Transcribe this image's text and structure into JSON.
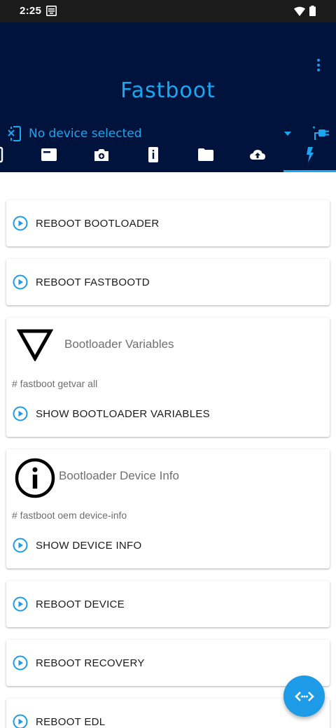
{
  "status_bar": {
    "time": "2:25"
  },
  "header": {
    "title": "Fastboot",
    "device_label": "No device selected"
  },
  "tabs": [
    {
      "icon": "phone-icon"
    },
    {
      "icon": "card-icon"
    },
    {
      "icon": "camera-icon"
    },
    {
      "icon": "info-icon"
    },
    {
      "icon": "folder-icon"
    },
    {
      "icon": "cloud-upload-icon"
    },
    {
      "icon": "flash-icon",
      "selected": true
    }
  ],
  "cards": {
    "reboot_bootloader": "REBOOT BOOTLOADER",
    "reboot_fastbootd": "REBOOT FASTBOOTD",
    "bootloader_variables": {
      "title": "Bootloader Variables",
      "command": "# fastboot getvar all",
      "action": "SHOW BOOTLOADER VARIABLES"
    },
    "device_info": {
      "title": "Bootloader Device Info",
      "command": "# fastboot oem device-info",
      "action": "SHOW DEVICE INFO"
    },
    "reboot_device": "REBOOT DEVICE",
    "reboot_recovery": "REBOOT RECOVERY",
    "reboot_edl": "REBOOT EDL"
  },
  "colors": {
    "header_bg": "#00133d",
    "accent": "#1aa7f0",
    "fab": "#1e9be6"
  }
}
